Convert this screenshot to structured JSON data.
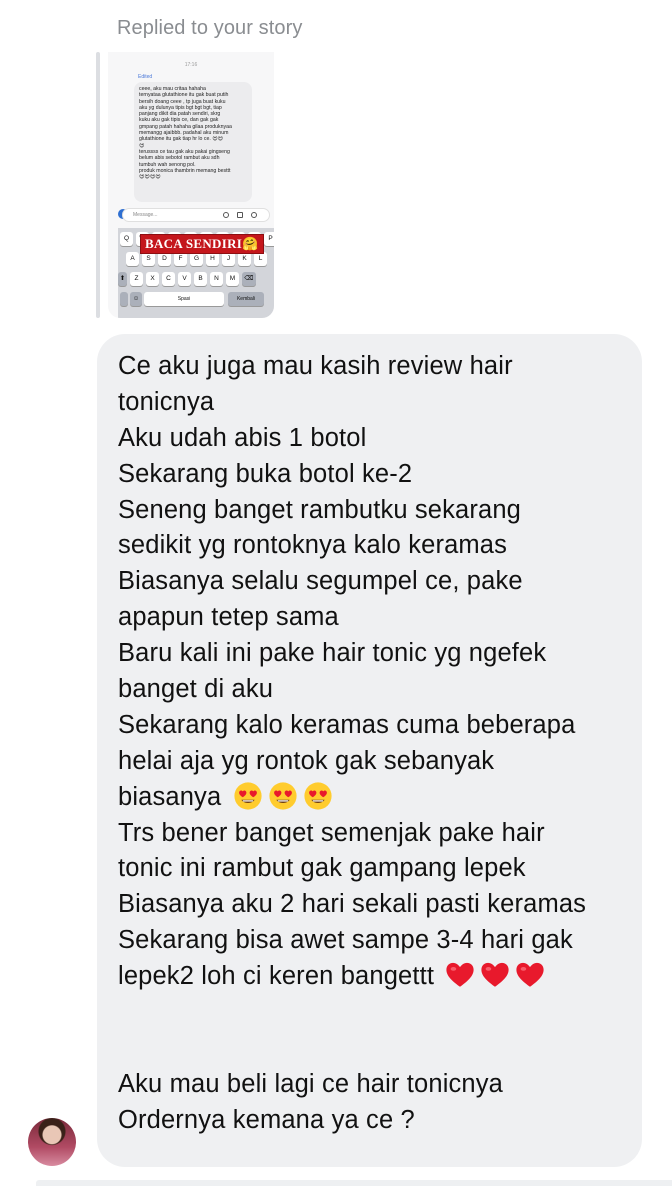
{
  "reply_label": "Replied to your story",
  "story": {
    "timestamp": "17:16",
    "edited_label": "Edited",
    "screenshot_lines": [
      "ceee, aku mau critaa hahaha",
      "ternyataa glutathione itu gak buat putih",
      "bersih doang ceee , tp juga buat kuku",
      "aku yg dulunya tipis bgt bgt bgt, tiap",
      "panjang dikit dia patah sendiri, skrg",
      "kuku aku gak tipis ce, dan gak gak",
      "gmpang patah hahaha gilaa produknyaa",
      "memangg ajaibbb. padahal aku minum",
      "glutathione itu gak tiap hr lo ce. 😍😍",
      "😍",
      "terussss ce tau gak aku pakai gingseng",
      "belum abis sebotol rambut aku sdh",
      "tumbuh wah senong pol.",
      "produk monica thambrin memang besttt",
      "😍😍😍😍"
    ],
    "message_placeholder": "Message...",
    "sticker_text": "BACA SENDIRI🤗",
    "keyboard_rows": [
      [
        "Q",
        "W",
        "E",
        "R",
        "T",
        "Y",
        "U",
        "I",
        "O",
        "P"
      ],
      [
        "A",
        "S",
        "D",
        "F",
        "G",
        "H",
        "J",
        "K",
        "L"
      ],
      [
        "Z",
        "X",
        "C",
        "V",
        "B",
        "N",
        "M"
      ]
    ],
    "space_label": "Spasi",
    "return_label": "Kembali"
  },
  "message_lines": [
    "Ce aku juga mau kasih review hair",
    "tonicnya",
    "Aku udah abis 1 botol",
    "Sekarang buka botol ke-2",
    "Seneng banget rambutku sekarang",
    "sedikit yg rontoknya kalo keramas",
    "Biasanya selalu segumpel ce, pake",
    "apapun tetep sama",
    "Baru kali ini pake hair tonic yg ngefek",
    "banget di aku",
    "Sekarang kalo keramas cuma beberapa",
    "helai aja yg rontok gak sebanyak",
    "biasanya",
    "Trs bener banget semenjak pake hair",
    "tonic ini rambut gak gampang lepek",
    "Biasanya aku 2 hari sekali pasti keramas",
    "Sekarang bisa awet sampe 3-4 hari gak",
    "lepek2 loh ci keren bangettt",
    "",
    "",
    "Aku mau beli lagi ce hair tonicnya",
    "Ordernya kemana ya ce ?"
  ],
  "emoji": {
    "line_13": [
      "heart-eyes-emoji",
      "heart-eyes-emoji",
      "heart-eyes-emoji"
    ],
    "line_18": [
      "red-heart-emoji",
      "red-heart-emoji",
      "red-heart-emoji"
    ]
  },
  "colors": {
    "bubble_bg": "#eff0f2",
    "reply_label": "#8a8d91",
    "sticker_red": "#c4161c",
    "heart_red": "#e8192c",
    "emoji_yellow": "#ffcc2e"
  },
  "avatar_alt": "sender-avatar"
}
